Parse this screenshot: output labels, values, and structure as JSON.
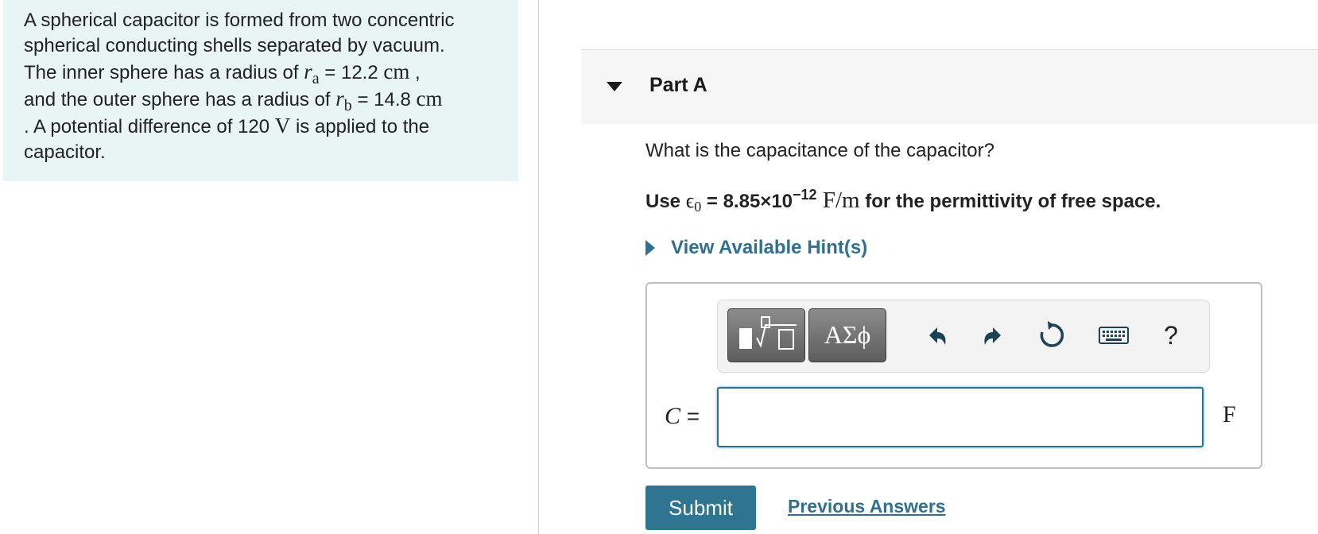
{
  "problem": {
    "line1": "A spherical capacitor is formed from two concentric",
    "line2": "spherical conducting shells separated by vacuum.",
    "line3_pre": "The inner sphere has a radius of ",
    "ra_symbol": "r",
    "ra_sub": "a",
    "ra_eq": " = 12.2 ",
    "ra_unit": "cm",
    "line3_post": " ,",
    "line4_pre": "and the outer sphere has a radius of ",
    "rb_symbol": "r",
    "rb_sub": "b",
    "rb_eq": " = 14.8 ",
    "rb_unit": "cm",
    "line5_pre": ". A potential difference of 120 ",
    "v_unit": "V",
    "line5_post": " is applied to the",
    "line6": "capacitor."
  },
  "part": {
    "title": "Part A"
  },
  "question": "What is the capacitance of the capacitor?",
  "constant": {
    "prefix": "Use ",
    "eps": "ϵ",
    "eps_sub": "0",
    "value": " = 8.85×10",
    "exponent": "−12",
    "unit": " F/m",
    "suffix": " for the permittivity of free space."
  },
  "hints": {
    "label": "View Available Hint(s)"
  },
  "toolbar": {
    "greek_label": "ΑΣϕ",
    "help_label": "?"
  },
  "answer": {
    "variable": "C",
    "equals": " =",
    "value": "",
    "unit": "F"
  },
  "actions": {
    "submit_label": "Submit",
    "previous_label": "Previous Answers"
  },
  "colors": {
    "accent": "#2f6f8f",
    "panel": "#e9f5f4",
    "submit": "#2f7592"
  }
}
